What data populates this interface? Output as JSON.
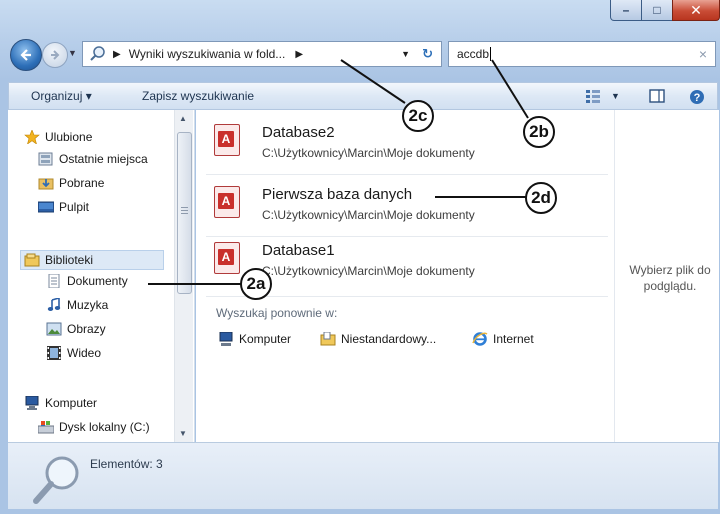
{
  "window": {
    "minimize": "–",
    "maximize": "□",
    "close": "✕"
  },
  "address": {
    "path": "Wyniki wyszukiwania w fold...",
    "refresh": "↻"
  },
  "search": {
    "value": "accdb",
    "clear": "×"
  },
  "toolbar": {
    "organize": "Organizuj ▾",
    "save_search": "Zapisz wyszukiwanie"
  },
  "nav": {
    "favorites": "Ulubione",
    "recent": "Ostatnie miejsca",
    "downloads": "Pobrane",
    "desktop": "Pulpit",
    "libraries": "Biblioteki",
    "documents": "Dokumenty",
    "music": "Muzyka",
    "pictures": "Obrazy",
    "video": "Wideo",
    "computer": "Komputer",
    "localdisk": "Dysk lokalny (C:)"
  },
  "results": [
    {
      "name": "Database2",
      "path": "C:\\Użytkownicy\\Marcin\\Moje dokumenty"
    },
    {
      "name": "Pierwsza baza danych",
      "path": "C:\\Użytkownicy\\Marcin\\Moje dokumenty"
    },
    {
      "name": "Database1",
      "path": "C:\\Użytkownicy\\Marcin\\Moje dokumenty"
    }
  ],
  "search_again": {
    "label": "Wyszukaj ponownie w:",
    "computer": "Komputer",
    "custom": "Niestandardowy...",
    "internet": "Internet"
  },
  "preview": {
    "message": "Wybierz plik do podglądu."
  },
  "status": {
    "count": "Elementów: 3"
  },
  "callouts": {
    "c2a": "2a",
    "c2b": "2b",
    "c2c": "2c",
    "c2d": "2d"
  },
  "colors": {
    "accent": "#2d6fb8",
    "access_red": "#c9302c",
    "close_red": "#c94c36"
  }
}
